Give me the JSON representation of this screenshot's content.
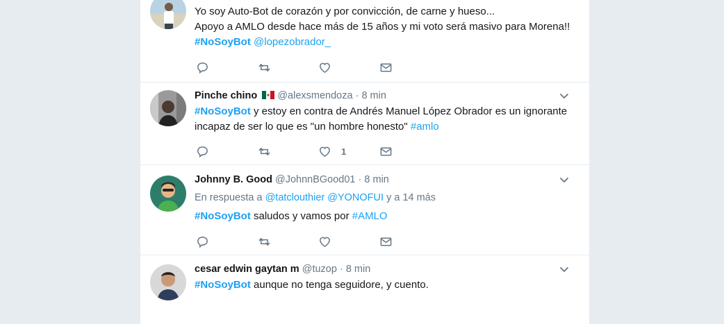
{
  "tweets": [
    {
      "name": "",
      "handle": "",
      "time": "",
      "lines": [
        "Yo soy Auto-Bot de corazón y por convicción, de carne y hueso...",
        "Apoyo a AMLO desde hace más de 15 años y mi voto será masivo para Morena!!"
      ],
      "tag": "#NoSoyBot",
      "mention": "@lopezobrador_"
    },
    {
      "name": "Pinche chino",
      "handle": "@alexsmendoza",
      "dot": "·",
      "time": "8 min",
      "tag": "#NoSoyBot",
      "text_a": " y estoy en contra de Andrés Manuel López Obrador es un ignorante",
      "text_b": "incapaz de ser lo que es \"un hombre honesto\" ",
      "tag2": "#amlo",
      "like_count": "1"
    },
    {
      "name": "Johnny B. Good",
      "handle": "@JohnnBGood01",
      "dot": "·",
      "time": "8 min",
      "reply_prefix": "En respuesta a ",
      "reply_user1": "@tatclouthier",
      "reply_user2": "@YONOFUI",
      "reply_suffix": " y a 14 más",
      "tag": "#NoSoyBot",
      "text": " saludos y vamos por ",
      "tag2": "#AMLO"
    },
    {
      "name": "cesar edwin gaytan m",
      "handle": "@tuzop",
      "dot": "·",
      "time": "8 min",
      "tag": "#NoSoyBot",
      "text": " aunque no tenga seguidore, y cuento."
    }
  ],
  "icons": {
    "reply": "reply-icon",
    "retweet": "retweet-icon",
    "like": "heart-icon",
    "dm": "envelope-icon",
    "caret": "chevron-down-icon",
    "flag": "mexico-flag-icon"
  },
  "colors": {
    "accent": "#1da1f2",
    "muted": "#657786",
    "background": "#e6ecf0"
  }
}
